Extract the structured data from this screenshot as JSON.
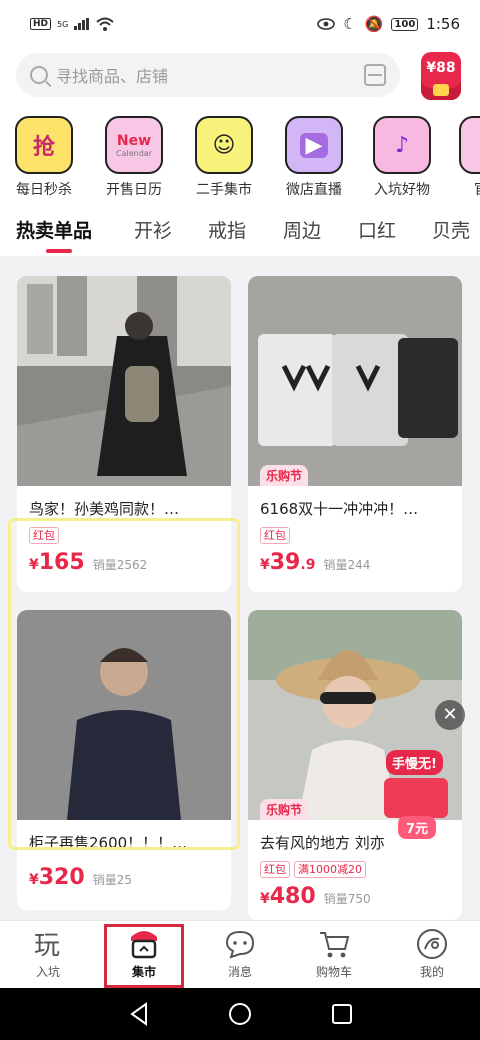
{
  "status": {
    "left_badge": "HD",
    "signal": "5G",
    "time": "1:56",
    "battery": "100"
  },
  "search": {
    "placeholder": "寻找商品、店铺"
  },
  "red_packet": {
    "amount": "¥88"
  },
  "categories": [
    {
      "label": "每日秒杀",
      "icon_text": "抢",
      "icon": "alarm-clock-icon",
      "bg": "#fde36a"
    },
    {
      "label": "开售日历",
      "icon_text": "New",
      "icon_sub": "Calendar",
      "icon": "calendar-icon",
      "bg": "#f8c7e6"
    },
    {
      "label": "二手集市",
      "icon_text": "☺",
      "icon": "cloud-market-icon",
      "bg": "#f6f27a"
    },
    {
      "label": "微店直播",
      "icon_text": "▶",
      "icon": "live-video-icon",
      "bg": "#d2b6f5"
    },
    {
      "label": "入坑好物",
      "icon_text": "♪",
      "icon": "megaphone-icon",
      "bg": "#f7b9e0"
    },
    {
      "label": "官方",
      "icon_text": "",
      "icon": "official-icon",
      "bg": "#f8c7e6"
    }
  ],
  "tabs": [
    "热卖单品",
    "开衫",
    "戒指",
    "周边",
    "口红",
    "贝壳"
  ],
  "products": [
    {
      "title": "鸟家！孙美鸡同款！…",
      "tags": [
        "红包"
      ],
      "price": "165",
      "decimal": "",
      "sold": "销量2562",
      "fest": ""
    },
    {
      "title": "6168双十一冲冲冲！…",
      "tags": [
        "红包"
      ],
      "price": "39",
      "decimal": ".9",
      "sold": "销量244",
      "fest": "乐购节"
    },
    {
      "title": "柜子再售2600！！！…",
      "tags": [],
      "price": "320",
      "decimal": "",
      "sold": "销量25",
      "fest": ""
    },
    {
      "title": "去有风的地方",
      "title_tail": "刘亦",
      "tags": [
        "红包",
        "满1000减20"
      ],
      "price": "480",
      "decimal": "",
      "sold": "销量750",
      "fest": "乐购节"
    }
  ],
  "promo": {
    "label": "手慢无!",
    "amount": "7元"
  },
  "price_symbol": "¥",
  "bottom_nav": [
    {
      "label": "入坑",
      "icon": "play-text-icon"
    },
    {
      "label": "集市",
      "icon": "market-shop-icon"
    },
    {
      "label": "消息",
      "icon": "chat-bubble-icon"
    },
    {
      "label": "购物车",
      "icon": "shopping-cart-icon"
    },
    {
      "label": "我的",
      "icon": "profile-icon"
    }
  ],
  "colors": {
    "accent": "#e8284a",
    "highlight": "#f7f08a"
  }
}
